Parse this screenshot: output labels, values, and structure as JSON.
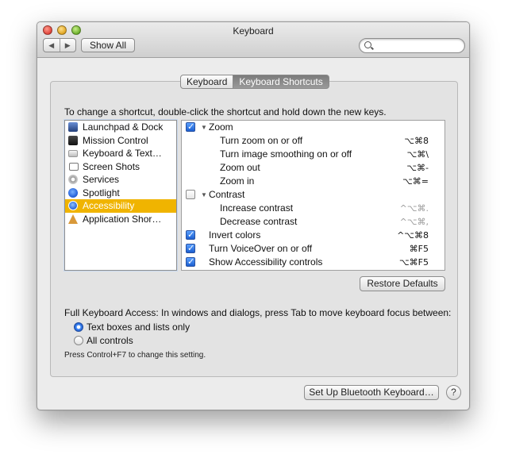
{
  "window": {
    "title": "Keyboard"
  },
  "toolbar": {
    "back_glyph": "◀",
    "forward_glyph": "▶",
    "show_all_label": "Show All",
    "search_placeholder": ""
  },
  "tabs": [
    {
      "label": "Keyboard",
      "selected": false
    },
    {
      "label": "Keyboard Shortcuts",
      "selected": true
    }
  ],
  "instructions": "To change a shortcut, double-click the shortcut and hold down the new keys.",
  "categories": [
    {
      "label": "Launchpad & Dock",
      "icon": "launchpad-icon",
      "selected": false
    },
    {
      "label": "Mission Control",
      "icon": "mission-control-icon",
      "selected": false
    },
    {
      "label": "Keyboard & Text…",
      "icon": "keyboard-icon",
      "selected": false
    },
    {
      "label": "Screen Shots",
      "icon": "camera-icon",
      "selected": false
    },
    {
      "label": "Services",
      "icon": "gear-icon",
      "selected": false
    },
    {
      "label": "Spotlight",
      "icon": "spotlight-icon",
      "selected": false
    },
    {
      "label": "Accessibility",
      "icon": "accessibility-icon",
      "selected": true
    },
    {
      "label": "Application Shor…",
      "icon": "app-shortcuts-icon",
      "selected": false
    }
  ],
  "shortcuts": [
    {
      "kind": "group",
      "checked": true,
      "expanded": true,
      "label": "Zoom",
      "shortcut": ""
    },
    {
      "kind": "item",
      "label": "Turn zoom on or off",
      "shortcut": "⌥⌘8",
      "dim": false
    },
    {
      "kind": "item",
      "label": "Turn image smoothing on or off",
      "shortcut": "⌥⌘\\",
      "dim": false
    },
    {
      "kind": "item",
      "label": "Zoom out",
      "shortcut": "⌥⌘-",
      "dim": false
    },
    {
      "kind": "item",
      "label": "Zoom in",
      "shortcut": "⌥⌘=",
      "dim": false
    },
    {
      "kind": "group",
      "checked": false,
      "expanded": true,
      "label": "Contrast",
      "shortcut": ""
    },
    {
      "kind": "item",
      "label": "Increase contrast",
      "shortcut": "^⌥⌘.",
      "dim": true
    },
    {
      "kind": "item",
      "label": "Decrease contrast",
      "shortcut": "^⌥⌘,",
      "dim": true
    },
    {
      "kind": "check",
      "checked": true,
      "label": "Invert colors",
      "shortcut": "^⌥⌘8"
    },
    {
      "kind": "check",
      "checked": true,
      "label": "Turn VoiceOver on or off",
      "shortcut": "⌘F5"
    },
    {
      "kind": "check",
      "checked": true,
      "label": "Show Accessibility controls",
      "shortcut": "⌥⌘F5"
    }
  ],
  "restore_defaults_label": "Restore Defaults",
  "full_keyboard_access": {
    "label": "Full Keyboard Access: In windows and dialogs, press Tab to move keyboard focus between:",
    "options": [
      {
        "label": "Text boxes and lists only",
        "selected": true
      },
      {
        "label": "All controls",
        "selected": false
      }
    ],
    "hint": "Press Control+F7 to change this setting."
  },
  "bluetooth_button_label": "Set Up Bluetooth Keyboard…",
  "help_label": "?",
  "colors": {
    "selection": "#f0b400",
    "checkbox_on": "#1c5fd0"
  }
}
